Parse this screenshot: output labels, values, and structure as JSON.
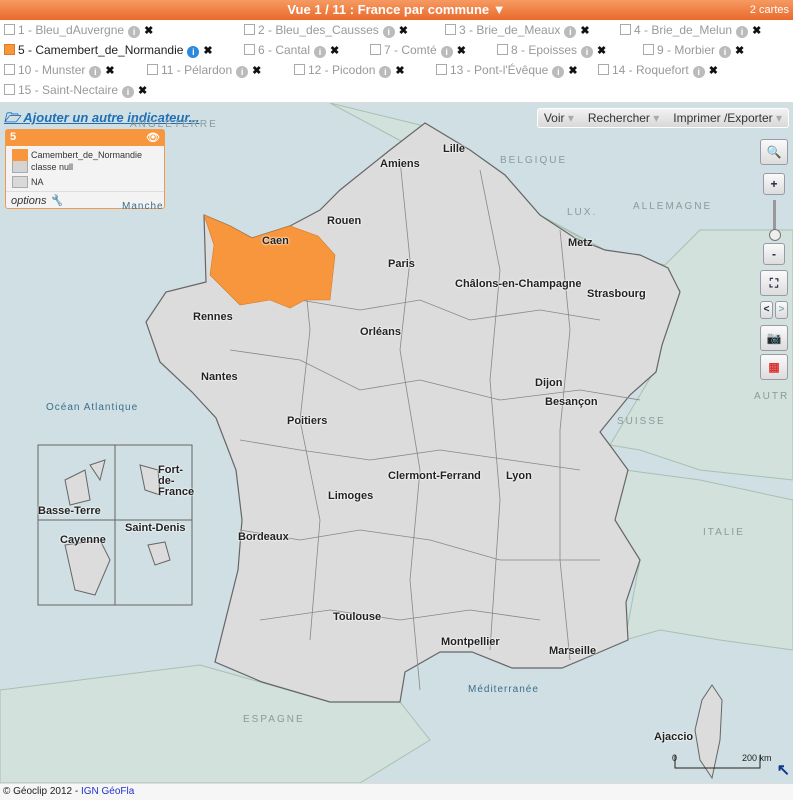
{
  "header": {
    "title": "Vue 1 / 11 : France par commune ▼",
    "map_count": "2 cartes"
  },
  "indicators": [
    {
      "label": "1 - Bleu_dAuvergne",
      "checked": false
    },
    {
      "label": "2 - Bleu_des_Causses",
      "checked": false
    },
    {
      "label": "3 - Brie_de_Meaux",
      "checked": false
    },
    {
      "label": "4 - Brie_de_Melun",
      "checked": false
    },
    {
      "label": "5 - Camembert_de_Normandie",
      "checked": true
    },
    {
      "label": "6 - Cantal",
      "checked": false
    },
    {
      "label": "7 - Comté",
      "checked": false
    },
    {
      "label": "8 - Epoisses",
      "checked": false
    },
    {
      "label": "9 - Morbier",
      "checked": false
    },
    {
      "label": "10 - Munster",
      "checked": false
    },
    {
      "label": "11 - Pélardon",
      "checked": false
    },
    {
      "label": "12 - Picodon",
      "checked": false
    },
    {
      "label": "13 - Pont-l'Évêque",
      "checked": false
    },
    {
      "label": "14 - Roquefort",
      "checked": false
    },
    {
      "label": "15 - Saint-Nectaire",
      "checked": false
    }
  ],
  "add_indicator": "Ajouter un autre indicateur...",
  "legend": {
    "number": "5",
    "items": [
      {
        "label": "Camembert_de_Normandie",
        "color": "#f7963c"
      },
      {
        "label": "classe null",
        "color": "#d4d4d4"
      },
      {
        "label": "NA",
        "color": "#d9d9d9"
      }
    ],
    "options": "options"
  },
  "toolbar": {
    "voir": "Voir",
    "rechercher": "Rechercher",
    "imprimer": "Imprimer /Exporter"
  },
  "zoom_controls": {
    "plus": "+",
    "minus": "-"
  },
  "countries": [
    "ANGLETERRE",
    "BELGIQUE",
    "LUX.",
    "ALLEMAGNE",
    "SUISSE",
    "ITALIE",
    "ESPAGNE",
    "AUTR"
  ],
  "seas": [
    "Manche",
    "Océan Atlantique",
    "Méditerranée"
  ],
  "cities": [
    "Lille",
    "Amiens",
    "Rouen",
    "Caen",
    "Paris",
    "Metz",
    "Châlons-en-Champagne",
    "Strasbourg",
    "Rennes",
    "Orléans",
    "Nantes",
    "Dijon",
    "Besançon",
    "Poitiers",
    "Clermont-Ferrand",
    "Lyon",
    "Limoges",
    "Bordeaux",
    "Toulouse",
    "Montpellier",
    "Marseille",
    "Ajaccio"
  ],
  "overseas": [
    "Basse-Terre",
    "Fort-de-France",
    "Cayenne",
    "Saint-Denis"
  ],
  "scale": {
    "zero": "0",
    "max": "200 km"
  },
  "footer": {
    "copyright": "© Géoclip 2012 - ",
    "link": "IGN GéoFla"
  },
  "colors": {
    "accent": "#ea6a2c",
    "selected": "#f7963c",
    "land": "#d9d9d9",
    "sea": "#cfdfe3"
  }
}
